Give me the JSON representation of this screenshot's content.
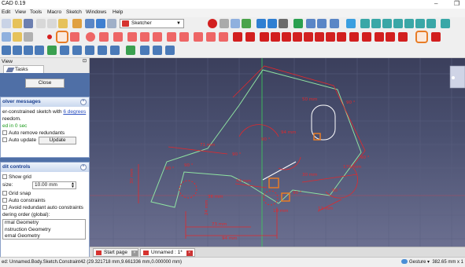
{
  "window": {
    "title": "CAD 0.19",
    "minimize": "–",
    "maximize": "❐"
  },
  "menu": [
    "Edit",
    "View",
    "Tools",
    "Macro",
    "Sketch",
    "Windows",
    "Help"
  ],
  "workbench": {
    "selected": "Sketcher"
  },
  "combo_view": {
    "title": "View",
    "tab": "Tasks",
    "close_label": "Close",
    "solver": {
      "title": "olver messages",
      "message_prefix": "er-constrained sketch with ",
      "message_link": "6 degrees",
      "message_suffix": "reedom.",
      "timing": "ed in 0 sec",
      "auto_remove": "Auto remove redundants",
      "auto_update": "Auto update",
      "update_label": "Update"
    },
    "edit_controls": {
      "title": "dit controls",
      "show_grid": "Show grid",
      "grid_size_label": " size:",
      "grid_size_value": "10.00 mm",
      "grid_snap": "Grid snap",
      "auto_constraints": "Auto constraints",
      "avoid_redundant": "Avoid redundant auto constraints",
      "rendering_order": "dering order (global):",
      "order_items": [
        "rmal Geometry",
        "nstruction Geometry",
        "ernal Geometry"
      ]
    }
  },
  "doc_tabs": [
    {
      "label": "Start page"
    },
    {
      "label": "Unnamed : 1*"
    }
  ],
  "status": {
    "left": "ed: Unnamed.Body.Sketch.Constraint42 (29.321718 mm,9.661336 mm,0.000000 mm)",
    "nav_style": "Gesture",
    "dimensions": "382.65 mm x 1"
  },
  "sketch_labels": {
    "dims": [
      "71 mm",
      "50 mm",
      "94 mm",
      "30 mm",
      "43 mm",
      "36 mm",
      "30 mm",
      "73 mm",
      "94 mm",
      "170 mm",
      "24 mm",
      "12 mm",
      "10 mm"
    ],
    "angles": [
      "90 °",
      "90 °",
      "90 °",
      "90 °",
      "90 °",
      "90 °",
      "90 °",
      "90 °"
    ]
  },
  "colors": {
    "accent": "#e87c26",
    "constraint": "#e2282c",
    "geometry": "#8fe3a2",
    "viewport_top": "#3b3f5c",
    "viewport_bottom": "#6b6f90"
  }
}
